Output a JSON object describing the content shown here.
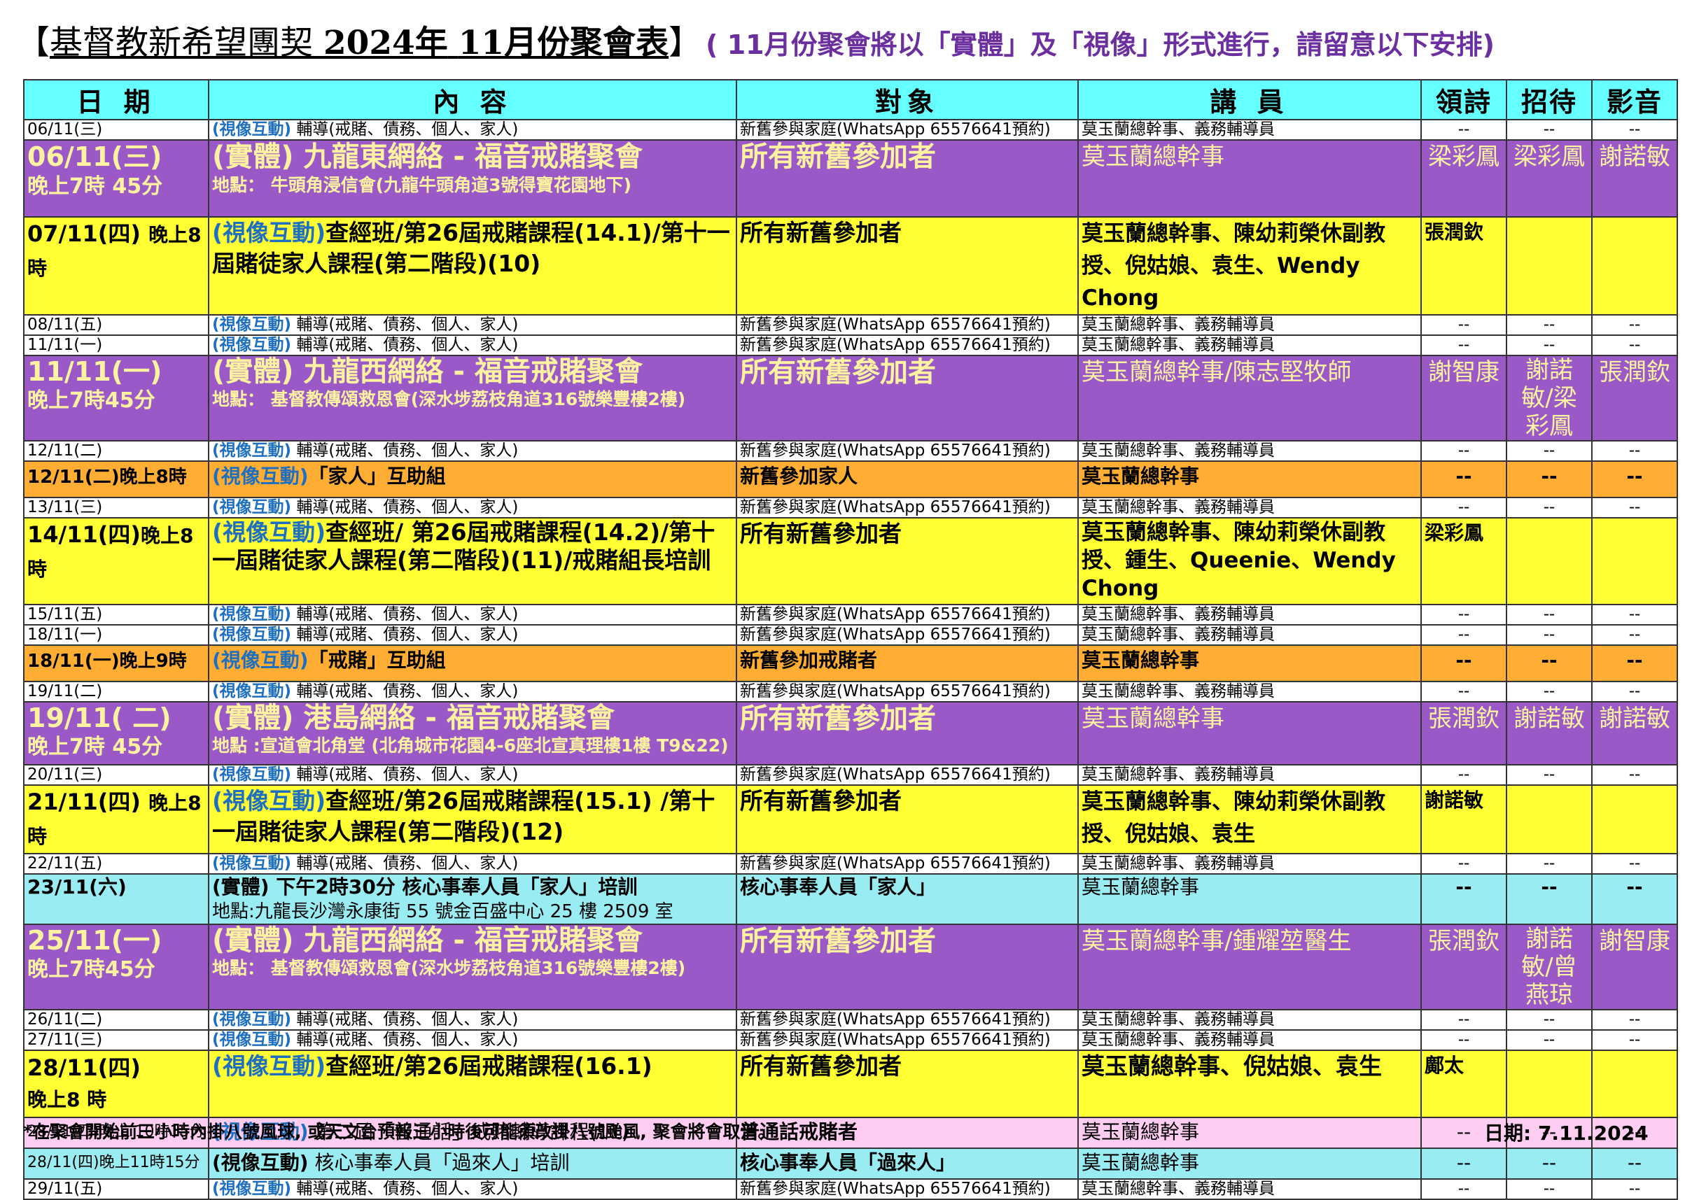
{
  "title": {
    "open": "【",
    "org": "基督教新希望團契",
    "year": "2024年",
    "month": "11月份聚會表",
    "close": "】",
    "note": "( 11月份聚會將以「實體」及「視像」形式進行，請留意以下安排)"
  },
  "headers": {
    "date": "日 期",
    "content": "內 容",
    "target": "對象",
    "speaker": "講 員",
    "poem": "領詩",
    "host": "招待",
    "media": "影音"
  },
  "common": {
    "tag_video": "(視像互動)",
    "counsel": "輔導(戒賭、債務、個人、家人)",
    "target_counsel": "新舊參與家庭(WhatsApp 65576641預約)",
    "speaker_counsel": "莫玉蘭總幹事、義務輔導員",
    "dash": "--"
  },
  "rows": {
    "r0611a": {
      "date": "06/11(三)"
    },
    "r0611b": {
      "date": "06/11(三)",
      "time": "晚上7時 45分",
      "title": "(實體) 九龍東網絡 - 福音戒賭聚會",
      "location": "地點： 牛頭角浸信會(九龍牛頭角道3號得寶花園地下)",
      "target": "所有新舊參加者",
      "speaker": "莫玉蘭總幹事",
      "poem": "梁彩鳳",
      "host": "梁彩鳳",
      "media": "謝諾敏"
    },
    "r0711": {
      "date": "07/11(四)",
      "time": "晚上8 時",
      "tag": "(視像互動)",
      "content": "查經班/第26屆戒賭課程(14.1)/第十一屆賭徒家人課程(第二階段)(10)",
      "target": "所有新舊參加者",
      "speaker": "莫玉蘭總幹事、陳幼莉榮休副教授、倪姑娘、袁生、Wendy Chong",
      "poem": "張潤欽"
    },
    "r0811": {
      "date": "08/11(五)"
    },
    "r1111a": {
      "date": "11/11(一)"
    },
    "r1111b": {
      "date": "11/11(一)",
      "time": "晚上7時45分",
      "title": "(實體) 九龍西網絡 - 福音戒賭聚會",
      "location": "地點： 基督教傳頌救恩會(深水埗荔枝角道316號樂豐樓2樓)",
      "target": "所有新舊參加者",
      "speaker": "莫玉蘭總幹事/陳志堅牧師",
      "poem": "謝智康",
      "host": "謝諾敏/梁彩鳳",
      "media": "張潤欽"
    },
    "r1211a": {
      "date": "12/11(二)"
    },
    "r1211b": {
      "date": "12/11(二)",
      "time": "晚上8時",
      "tag": "(視像互動)",
      "content": "「家人」互助組",
      "target": "新舊參加家人",
      "speaker": "莫玉蘭總幹事"
    },
    "r1311": {
      "date": "13/11(三)"
    },
    "r1411": {
      "date": "14/11(四)",
      "time": "晚上8 時",
      "tag": "(視像互動)",
      "content": "查經班/ 第26屆戒賭課程(14.2)/第十一屆賭徒家人課程(第二階段)(11)/戒賭組長培訓",
      "target": "所有新舊參加者",
      "speaker": "莫玉蘭總幹事、陳幼莉榮休副教授、鍾生、Queenie、Wendy Chong",
      "poem": "梁彩鳳"
    },
    "r1511": {
      "date": "15/11(五)"
    },
    "r1811a": {
      "date": "18/11(一)"
    },
    "r1811b": {
      "date": "18/11(一)",
      "time": "晚上9時",
      "tag": "(視像互動)",
      "content": "「戒賭」互助組",
      "target": "新舊參加戒賭者",
      "speaker": "莫玉蘭總幹事"
    },
    "r1911a": {
      "date": "19/11(二)"
    },
    "r1911b": {
      "date": "19/11( 二)",
      "time": "晚上7時 45分",
      "title": "(實體) 港島網絡 - 福音戒賭聚會",
      "location": "地點 :宣道會北角堂 (北角城市花園4-6座北宣真理樓1樓 T9&22)",
      "target": "所有新舊參加者",
      "speaker": "莫玉蘭總幹事",
      "poem": "張潤欽",
      "host": "謝諾敏",
      "media": "謝諾敏"
    },
    "r2011": {
      "date": "20/11(三)"
    },
    "r2111": {
      "date": "21/11(四)",
      "time": "晚上8時",
      "tag": "(視像互動)",
      "content": "查經班/第26屆戒賭課程(15.1) /第十一屆賭徒家人課程(第二階段)(12)",
      "target": "所有新舊參加者",
      "speaker": "莫玉蘭總幹事、陳幼莉榮休副教授、倪姑娘、袁生",
      "poem": "謝諾敏"
    },
    "r2211": {
      "date": "22/11(五)"
    },
    "r2311": {
      "date": "23/11(六)",
      "tag": "(實體)",
      "content": "下午2時30分 核心事奉人員「家人」培訓",
      "location": "地點:九龍長沙灣永康街 55 號金百盛中心 25 樓 2509 室",
      "target": "核心事奉人員「家人」",
      "speaker": "莫玉蘭總幹事"
    },
    "r2511b": {
      "date": "25/11(一)",
      "time": "晚上7時45分",
      "title": "(實體) 九龍西網絡 - 福音戒賭聚會",
      "location": "地點： 基督教傳頌救恩會(深水埗荔枝角道316號樂豐樓2樓)",
      "target": "所有新舊參加者",
      "speaker": "莫玉蘭總幹事/鍾耀堃醫生",
      "poem": "張潤欽",
      "host": "謝諾敏/曾燕琼",
      "media": "謝智康"
    },
    "r2611": {
      "date": "26/11(二)"
    },
    "r2711": {
      "date": "27/11(三)"
    },
    "r2811a": {
      "date": "28/11(四)",
      "time": "晚上8 時",
      "tag": "(視像互動)",
      "content": "查經班/第26屆戒賭課程(16.1)",
      "target": "所有新舊參加者",
      "speaker": "莫玉蘭總幹事、倪姑娘、袁生",
      "poem": "鄺太"
    },
    "r2811b": {
      "date": "28/11(四)晚上 10時15分",
      "tag": "(視像互動)",
      "content": "第二屆「普通話」戒賭輔導課程(11)",
      "target": "普通話戒賭者",
      "speaker": "莫玉蘭總幹事"
    },
    "r2811c": {
      "date": "28/11(四)晚上11時15分",
      "tag": "(視像互動)",
      "content": "核心事奉人員「過來人」培訓",
      "target": "核心事奉人員「過來人」",
      "speaker": "莫玉蘭總幹事"
    },
    "r2911": {
      "date": "29/11(五)"
    }
  },
  "footnote": "*在聚會開始前三小時內掛八號風球, 或天文台預報三小時後可能須改掛八號颱風, 聚會將會取消。",
  "issue_date": "日期: 7.11.2024",
  "colors": {
    "header": "#66ffff",
    "purple": "#9b59c8",
    "yellow": "#ffff33",
    "orange": "#ffad33",
    "cyan": "#99ecf2",
    "pink": "#ffccf2",
    "note": "#6b2fa0"
  }
}
